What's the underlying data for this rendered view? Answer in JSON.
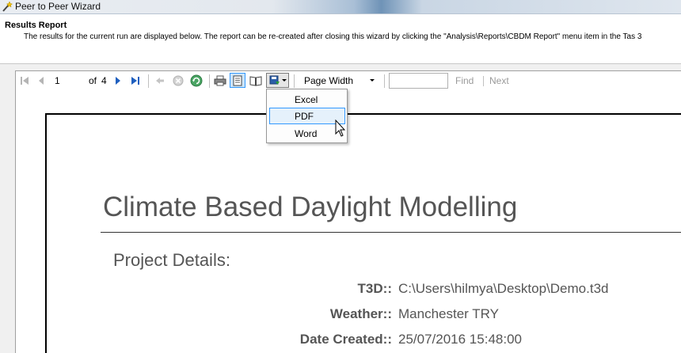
{
  "window": {
    "title": "Peer to Peer Wizard"
  },
  "header": {
    "title": "Results Report",
    "description": "The results for the current run are displayed below. The report can be re-created after closing this wizard by clicking the \"Analysis\\Reports\\CBDM Report\" menu item in the Tas 3"
  },
  "toolbar": {
    "current_page": "1",
    "of_label": "of",
    "total_pages": "4",
    "zoom_value": "Page Width",
    "find_label": "Find",
    "next_label": "Next",
    "find_placeholder": ""
  },
  "export_menu": {
    "items": [
      "Excel",
      "PDF",
      "Word"
    ],
    "highlighted": "PDF"
  },
  "report": {
    "title": "Climate Based Daylight Modelling",
    "section_title": "Project Details:",
    "details": [
      {
        "label": "T3D::",
        "value": "C:\\Users\\hilmya\\Desktop\\Demo.t3d"
      },
      {
        "label": "Weather::",
        "value": "Manchester TRY"
      },
      {
        "label": "Date Created::",
        "value": "25/07/2016 15:48:00"
      }
    ]
  },
  "colors": {
    "accent_blue": "#1f5fbf",
    "menu_hover": "#e5f1fb",
    "menu_hover_border": "#3399ff",
    "report_text": "#555555"
  }
}
